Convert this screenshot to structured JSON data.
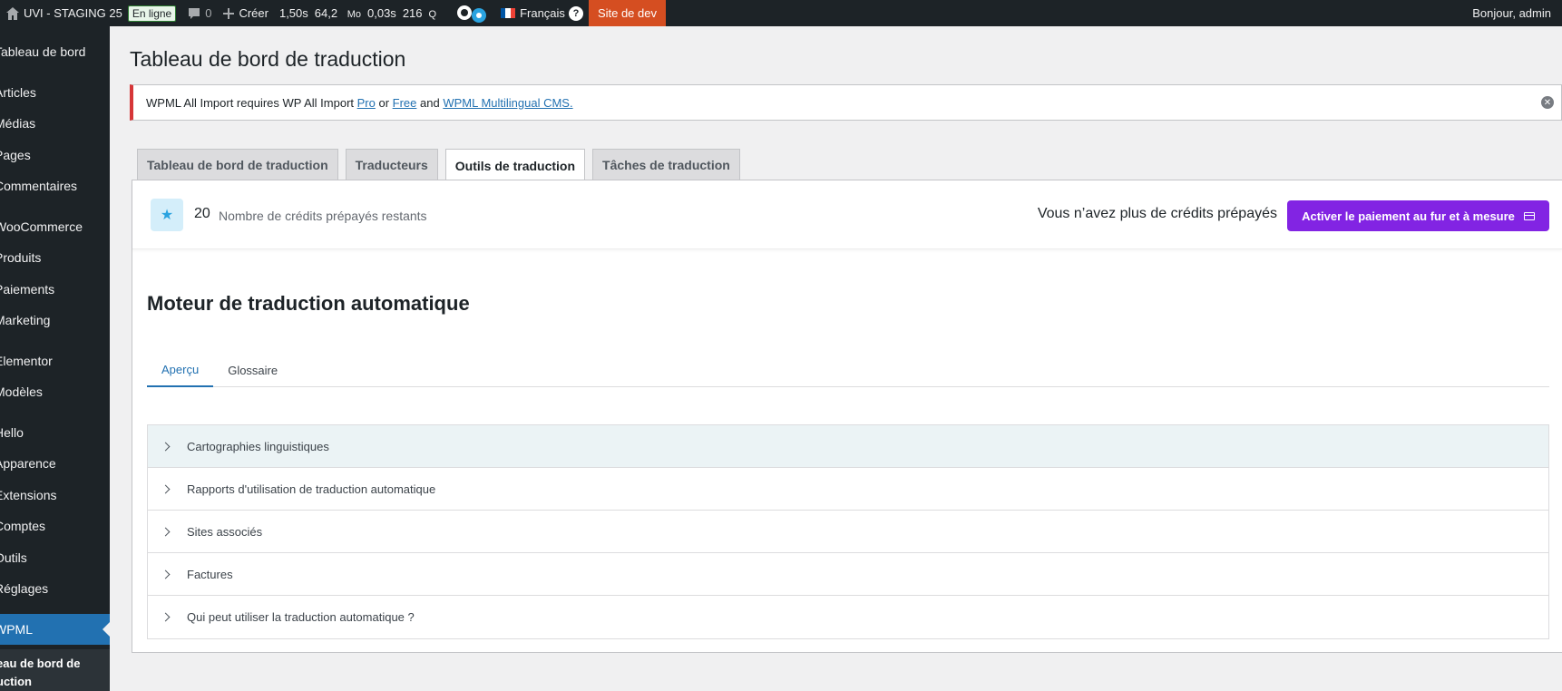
{
  "adminbar": {
    "site_name": "UVI - STAGING 25",
    "status_badge": "En ligne",
    "comments_count": "0",
    "create_label": "Créer",
    "perf_time": "1,50s",
    "perf_mem": "64,2",
    "perf_mem_unit": "Mo",
    "perf_db_time": "0,03s",
    "perf_queries": "216",
    "perf_queries_unit": "Q",
    "language": "Français",
    "dev_label": "Site de dev",
    "greeting": "Bonjour, admin"
  },
  "sidebar": {
    "items": [
      {
        "label": "Tableau de bord"
      },
      {
        "label": "Articles"
      },
      {
        "label": "Médias"
      },
      {
        "label": "Pages"
      },
      {
        "label": "Commentaires"
      },
      {
        "label": "WooCommerce"
      },
      {
        "label": "Produits"
      },
      {
        "label": "Paiements"
      },
      {
        "label": "Marketing"
      },
      {
        "label": "Elementor"
      },
      {
        "label": "Modèles"
      },
      {
        "label": "Hello"
      },
      {
        "label": "Apparence"
      },
      {
        "label": "Extensions"
      },
      {
        "label": "Comptes"
      },
      {
        "label": "Outils"
      },
      {
        "label": "Réglages"
      },
      {
        "label": "WPML"
      }
    ],
    "submenu_line1": "eau de bord de",
    "submenu_line2": "uction"
  },
  "page": {
    "title": "Tableau de bord de traduction"
  },
  "notice": {
    "text_before": "WPML All Import requires WP All Import ",
    "link_pro": "Pro",
    "text_or": " or ",
    "link_free": "Free",
    "text_and": " and ",
    "link_cms": "WPML Multilingual CMS.",
    "dismiss": "✕"
  },
  "tabs": [
    {
      "label": "Tableau de bord de traduction"
    },
    {
      "label": "Traducteurs"
    },
    {
      "label": "Outils de traduction",
      "active": true
    },
    {
      "label": "Tâches de traduction"
    }
  ],
  "credits": {
    "count": "20",
    "label": "Nombre de crédits prépayés restants",
    "no_credit_text": "Vous n’avez plus de crédits prépayés",
    "button_label": "Activer le paiement au fur et à mesure"
  },
  "engine": {
    "title": "Moteur de traduction automatique",
    "subtabs": [
      {
        "label": "Aperçu",
        "active": true
      },
      {
        "label": "Glossaire"
      }
    ],
    "sections": [
      {
        "label": "Cartographies linguistiques"
      },
      {
        "label": "Rapports d'utilisation de traduction automatique"
      },
      {
        "label": "Sites associés"
      },
      {
        "label": "Factures"
      },
      {
        "label": "Qui peut utiliser la traduction automatique ?"
      }
    ]
  },
  "colors": {
    "adminbar_bg": "#1d2327",
    "active_menu": "#2271b1",
    "dev_badge": "#d54e21",
    "pay_button": "#8224e3",
    "notice_border": "#d63638"
  }
}
